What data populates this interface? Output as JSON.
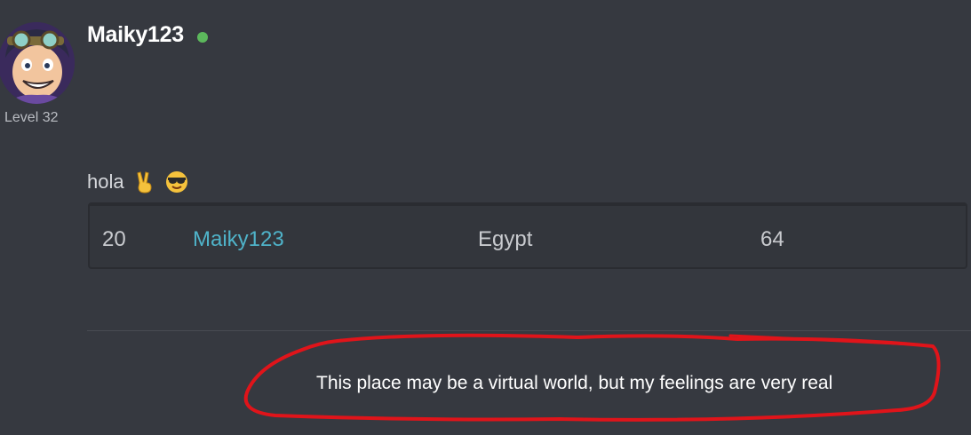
{
  "user": {
    "username": "Maiky123",
    "level": "Level 32",
    "online": true,
    "status_color": "#5cb85c",
    "avatar_icon": "anime-boy-avatar"
  },
  "post": {
    "text": "hola",
    "emojis": [
      "victory-hand-emoji",
      "sunglasses-face-emoji"
    ]
  },
  "embed_table": {
    "rows": [
      {
        "rank": "20",
        "name": "Maiky123",
        "country": "Egypt",
        "score": "64"
      }
    ],
    "link_color": "#4fb3c9"
  },
  "signature": {
    "text": "This place may be a virtual world, but my feelings are very real",
    "annotation_color": "#e0141a"
  }
}
